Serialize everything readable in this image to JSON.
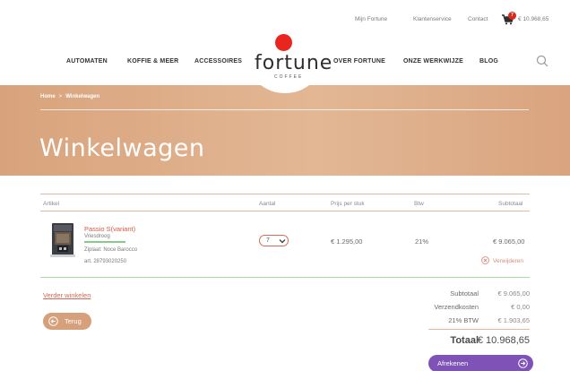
{
  "utility": {
    "links": [
      "Mijn Fortune",
      "Klantenservice",
      "Contact"
    ],
    "cart_count": "7",
    "cart_total": "€ 10.968,65",
    "cart_icon": "cart-icon"
  },
  "logo": {
    "word": "fortune",
    "sub": "COFFEE"
  },
  "nav": {
    "left": [
      "AUTOMATEN",
      "KOFFIE & MEER",
      "ACCESSOIRES"
    ],
    "right": [
      "OVER FORTUNE",
      "ONZE WERKWIJZE",
      "BLOG"
    ],
    "search_icon": "search-icon"
  },
  "hero": {
    "breadcrumb": [
      "Home",
      "Winkelwagen"
    ],
    "breadcrumb_sep": ">",
    "title": "Winkelwagen"
  },
  "table": {
    "headers": [
      "Artikel",
      "Aantal",
      "Prijs per stuk",
      "Btw",
      "Subtotaal"
    ],
    "item": {
      "name": "Passio S(variant)",
      "variant": "Vriesdroog",
      "zip": "Ziplaat: Noce Barocco",
      "art": "art. 28793020250",
      "quantity": "7",
      "price": "€ 1.295,00",
      "btw": "21%",
      "subtotal": "€ 9.065,00",
      "remove_label": "Verwijderen"
    }
  },
  "footer": {
    "continue_label": "Verder winkelen",
    "back_label": "Terug",
    "summary": [
      {
        "label": "Subtotaal",
        "value": "€ 9.065,00"
      },
      {
        "label": "Verzendkosten",
        "value": "€ 0,00"
      },
      {
        "label": "21% BTW",
        "value": "€ 1.903,65"
      }
    ],
    "total_label": "Totaal",
    "total_value": "€ 10.968,65",
    "checkout_label": "Afrekenen"
  },
  "colors": {
    "accent": "#d65743",
    "hero": "#dfae88",
    "checkout": "#7f52b8",
    "logo_red": "#e8261d"
  }
}
